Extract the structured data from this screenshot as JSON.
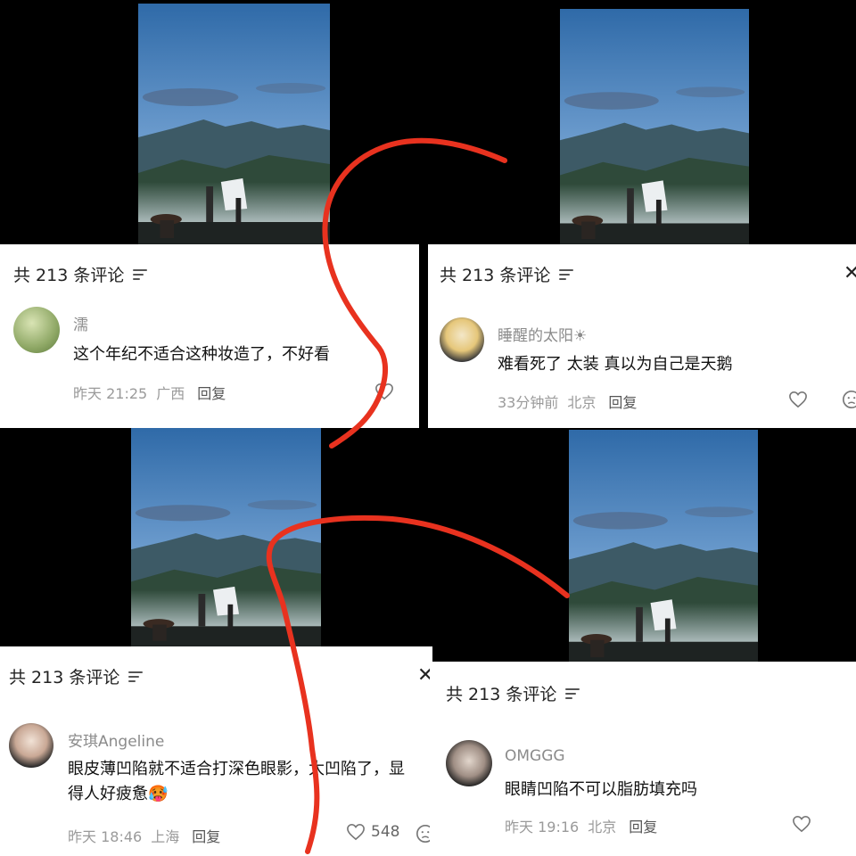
{
  "colors": {
    "background": "#000000",
    "panel": "#ffffff",
    "annotation": "#e8321f"
  },
  "panels": [
    {
      "header": "共 213 条评论",
      "show_close": false,
      "user": "濡",
      "comment_lines": [
        "这个年纪不适合这种妆造了，不好看"
      ],
      "time": "昨天 21:25",
      "location": "广西",
      "reply_label": "回复",
      "likes": ""
    },
    {
      "header": "共 213 条评论",
      "show_close": true,
      "user": "睡醒的太阳☀",
      "comment_lines": [
        "难看死了 太装 真以为自己是天鹅"
      ],
      "time": "33分钟前",
      "location": "北京",
      "reply_label": "回复",
      "likes": ""
    },
    {
      "header": "共 213 条评论",
      "show_close": true,
      "user": "安琪Angeline",
      "comment_lines": [
        "眼皮薄凹陷就不适合打深色眼影，太凹陷了，显",
        "得人好疲惫🥵"
      ],
      "time": "昨天 18:46",
      "location": "上海",
      "reply_label": "回复",
      "likes": "548"
    },
    {
      "header": "共 213 条评论",
      "show_close": false,
      "user": "OMGGG",
      "comment_lines": [
        "眼睛凹陷不可以脂肪填充吗"
      ],
      "time": "昨天 19:16",
      "location": "北京",
      "reply_label": "回复",
      "likes": ""
    }
  ],
  "icons": {
    "sort": "sort-icon",
    "close": "close-icon",
    "like": "heart-icon",
    "dislike": "dislike-icon"
  },
  "close_glyph": "✕"
}
